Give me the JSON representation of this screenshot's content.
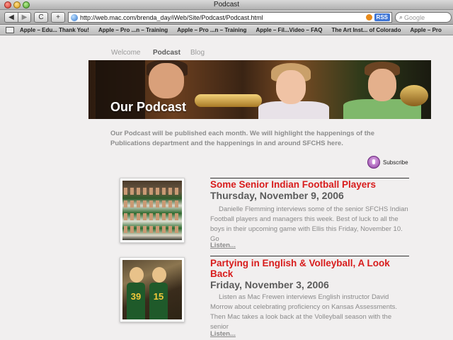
{
  "window": {
    "title": "Podcast"
  },
  "toolbar": {
    "back_label": "◀",
    "forward_label": "▶",
    "reload_label": "C",
    "add_label": "+",
    "url": "http://web.mac.com/brenda_day/iWeb/Site/Podcast/Podcast.html",
    "rss_label": "RSS",
    "search_placeholder": "Google"
  },
  "bookmarks": [
    "Apple – Edu... Thank You!",
    "Apple – Pro ...n – Training",
    "Apple – Pro ...n – Training",
    "Apple – Fil...Video – FAQ",
    "The Art Inst... of Colorado",
    "Apple – Pro"
  ],
  "nav": {
    "items": [
      "Welcome",
      "Podcast",
      "Blog"
    ],
    "active": "Podcast"
  },
  "banner": {
    "title": "Our Podcast"
  },
  "intro": "Our Podcast will be published each month. We will highlight the happenings of the Publications department and the happenings in and around SFCHS here.",
  "subscribe": {
    "label": "Subscribe",
    "icon": "podcast-icon"
  },
  "entries": [
    {
      "title": "Some Senior Indian Football Players",
      "date": "Thursday, November 9, 2006",
      "description": "Danielle Flemming interviews some of the senior SFCHS Indian Football players and managers this week. Best of luck to all the boys in their upcoming game with Ellis this Friday, November 10. Go",
      "link": "Listen..."
    },
    {
      "title": "Partying in English & Volleyball, A Look Back",
      "date": "Friday, November 3, 2006",
      "description": "Listen as Mac Frewen interviews English instructor David Morrow about celebrating proficiency on Kansas Assessments. Then Mac takes a look back at the Volleyball season with the senior",
      "link": "Listen...",
      "jersey_numbers": [
        "39",
        "15"
      ]
    }
  ],
  "colors": {
    "page_bg": "#f1efef",
    "entry_title": "#d81c1c",
    "muted_text": "#8a8a8a"
  }
}
